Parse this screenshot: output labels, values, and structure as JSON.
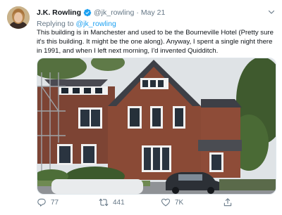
{
  "tweet": {
    "author_name": "J.K. Rowling",
    "handle": "@jk_rowling",
    "separator": "·",
    "date": "May 21",
    "reply_prefix": "Replying to",
    "reply_to": "@jk_rowling",
    "text": "This building is in Manchester and used to be the Bourneville Hotel (Pretty sure it's this building. It might be the one along). Anyway, I spent a single night there in 1991, and when I left next morning, I'd invented Quidditch."
  },
  "actions": {
    "replies": "77",
    "retweets": "441",
    "likes": "7K"
  },
  "icons": {
    "verified": "verified-badge-icon",
    "caret": "chevron-down-icon",
    "reply": "reply-icon",
    "retweet": "retweet-icon",
    "like": "heart-icon",
    "share": "share-icon"
  },
  "colors": {
    "accent": "#1da1f2",
    "muted": "#657786",
    "text": "#0f1419"
  }
}
